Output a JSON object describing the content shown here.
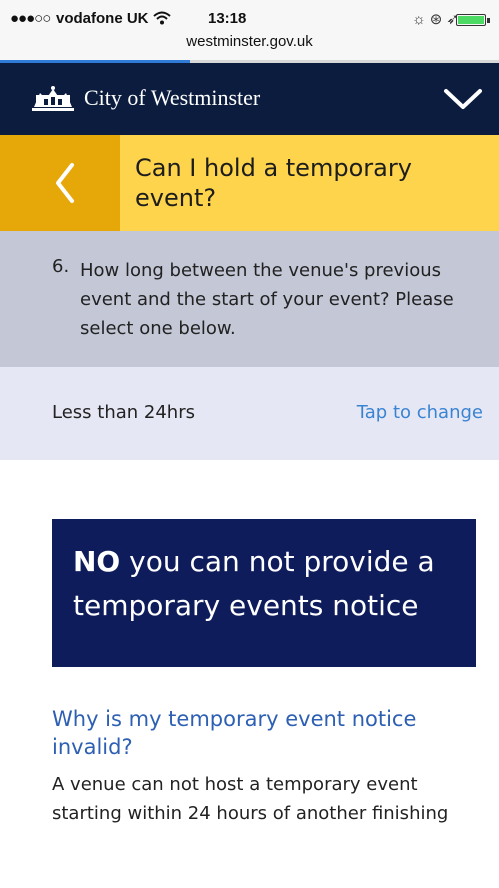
{
  "status_bar": {
    "signal": "●●●○○",
    "carrier": "vodafone UK",
    "time": "13:18",
    "url": "westminster.gov.uk",
    "load_progress": 0.38,
    "battery_color": "#4cd964"
  },
  "header": {
    "brand": "City of Westminster",
    "crest_icon": "westminster-crest-icon",
    "menu_icon": "chevron-down-icon",
    "background": "#0b1c3f"
  },
  "title_band": {
    "title": "Can I hold a temporary event?",
    "back_icon": "chevron-left-icon",
    "accent": "#fdd44b",
    "back_bg": "#e6a709"
  },
  "question": {
    "number": "6.",
    "text": "How long between the venue's previous event and the start of your event? Please select one below."
  },
  "answer": {
    "value": "Less than 24hrs",
    "change_label": "Tap to change"
  },
  "result": {
    "verdict": "NO",
    "message": " you can not provide a temporary events notice",
    "background": "#0f1c5c"
  },
  "explanation": {
    "heading": "Why is my temporary event notice invalid?",
    "body": "A venue can not host a temporary event starting within 24 hours of another finishing"
  }
}
